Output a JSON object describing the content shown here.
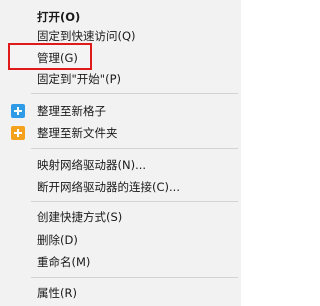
{
  "context_menu": {
    "items": {
      "open": "打开(O)",
      "pin_quick_access": "固定到快速访问(Q)",
      "manage": "管理(G)",
      "pin_start": "固定到\"开始\"(P)",
      "organize_new_grid": "整理至新格子",
      "organize_new_folder": "整理至新文件夹",
      "map_network_drive": "映射网络驱动器(N)...",
      "disconnect_network_drive": "断开网络驱动器的连接(C)...",
      "create_shortcut": "创建快捷方式(S)",
      "delete": "删除(D)",
      "rename": "重命名(M)",
      "properties": "属性(R)"
    },
    "icons": {
      "organize_new_grid": "blue-plus-square-icon",
      "organize_new_folder": "orange-plus-square-icon"
    },
    "colors": {
      "highlight_border": "#e01a1a",
      "grid_icon": "#2f9be6",
      "folder_icon": "#f4a21d"
    }
  }
}
